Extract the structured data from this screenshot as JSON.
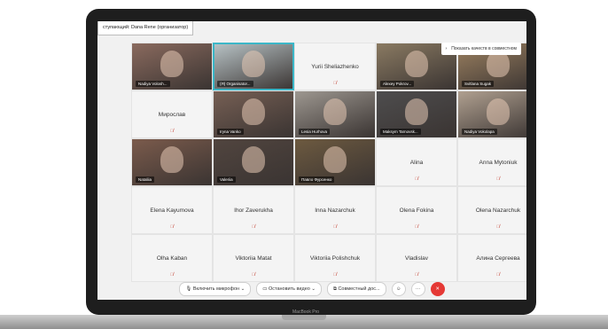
{
  "header": {
    "speaker_text": "ступающий: Dana Rene (организатор)"
  },
  "notice": {
    "text": "Показать качеств в совместном"
  },
  "participants": [
    {
      "name": "Nadiya Volosh...",
      "video": true,
      "tone": "#8a6a5e"
    },
    {
      "name": "(Я) Organisator...",
      "video": true,
      "tone": "#b8c3c6",
      "active": true
    },
    {
      "name": "Yurii Sheliazhenko",
      "video": false
    },
    {
      "name": "Alexey Pokrov...",
      "video": true,
      "tone": "#8a7a62"
    },
    {
      "name": "Svitlana Sugak",
      "video": true,
      "tone": "#9b8060"
    },
    {
      "name": "Мирослав",
      "video": false
    },
    {
      "name": "Iryna Vanko",
      "video": true,
      "tone": "#765f54"
    },
    {
      "name": "Lesia Hurhova",
      "video": true,
      "tone": "#9d9790"
    },
    {
      "name": "Maksym Tarnovsk...",
      "video": true,
      "tone": "#4e4d4e"
    },
    {
      "name": "Nadiya Vokolapa",
      "video": true,
      "tone": "#b0a090"
    },
    {
      "name": "Nataliia",
      "video": true,
      "tone": "#7b5b4c"
    },
    {
      "name": "Valeriia",
      "video": true,
      "tone": "#51453f"
    },
    {
      "name": "Павло Фурсенко",
      "video": true,
      "tone": "#6d5a40"
    },
    {
      "name": "Alina",
      "video": false
    },
    {
      "name": "Anna Mytoniuk",
      "video": false
    },
    {
      "name": "Elena Kayumova",
      "video": false
    },
    {
      "name": "Ihor Zaverukha",
      "video": false
    },
    {
      "name": "Inna Nazarchuk",
      "video": false
    },
    {
      "name": "Olena Fokina",
      "video": false
    },
    {
      "name": "Olena Nazarchuk",
      "video": false
    },
    {
      "name": "Olha Kaban",
      "video": false
    },
    {
      "name": "Viktoriia Matat",
      "video": false
    },
    {
      "name": "Viktoriia Polishchuk",
      "video": false
    },
    {
      "name": "Vladislav",
      "video": false
    },
    {
      "name": "Алина Сергеева",
      "video": false
    }
  ],
  "toolbar": {
    "mic_label": "Включить микрофон",
    "video_label": "Остановить видео",
    "share_label": "Совместный дос...",
    "dropdown_glyph": "⌄",
    "more_glyph": "···",
    "emoji_glyph": "☺",
    "end_glyph": "✕"
  },
  "laptop": {
    "brand": "MacBook Pro"
  }
}
